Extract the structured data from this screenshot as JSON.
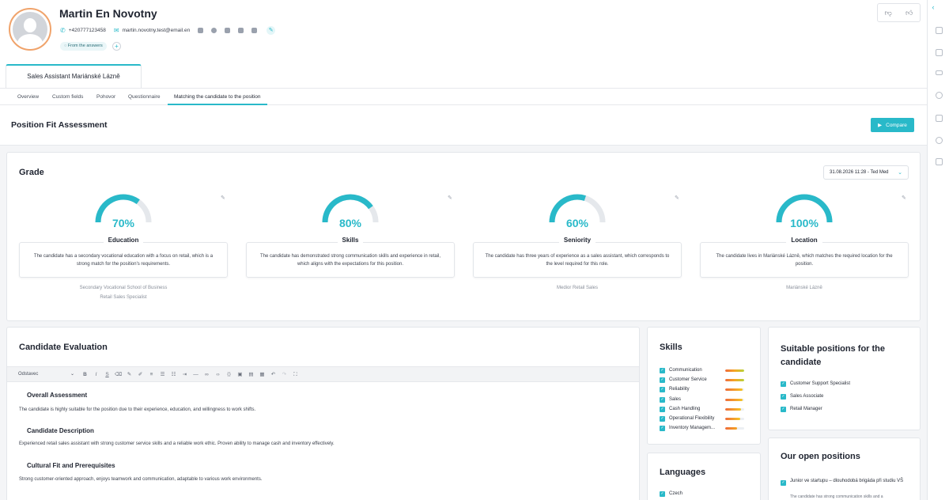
{
  "candidate": {
    "name": "Martin En Novotny",
    "phone": "+420777123458",
    "email": "martin.novotny.test@email.en",
    "answers_tag": "From the answers",
    "add_label": "+"
  },
  "position_tab": "Sales Assistant Mariánské Lázně",
  "subtabs": [
    "Overview",
    "Custom fields",
    "Pohovor",
    "Questionnaire",
    "Matching the candidate to the position"
  ],
  "header": {
    "title": "Position Fit Assessment",
    "compare_label": "Compare"
  },
  "grade": {
    "title": "Grade",
    "date_select": "31.08.2026 11:28 - Ted Med",
    "gauges": [
      {
        "label": "Education",
        "value": 70,
        "value_text": "70%",
        "description": "The candidate has a secondary vocational education with a focus on retail, which is a strong match for the position's requirements.",
        "extra": [
          "Secondary Vocational School of Business",
          "Retail Sales Specialist"
        ]
      },
      {
        "label": "Skills",
        "value": 80,
        "value_text": "80%",
        "description": "The candidate has demonstrated strong communication skills and experience in retail, which aligns with the expectations for this position.",
        "extra": []
      },
      {
        "label": "Seniority",
        "value": 60,
        "value_text": "60%",
        "description": "The candidate has three years of experience as a sales assistant, which corresponds to the level required for this role.",
        "extra": [
          "Medior Retail Sales"
        ]
      },
      {
        "label": "Location",
        "value": 100,
        "value_text": "100%",
        "description": "The candidate lives in Mariánské Lázně, which matches the required location for the position.",
        "extra": [
          "Mariánské Lázně"
        ]
      }
    ]
  },
  "evaluation": {
    "title": "Candidate Evaluation",
    "toolbar_paragraph": "Odstavec",
    "sections": [
      {
        "heading": "Overall Assessment",
        "text": "The candidate is highly suitable for the position due to their experience, education, and willingness to work shifts."
      },
      {
        "heading": "Candidate Description",
        "text": "Experienced retail sales assistant with strong customer service skills and a reliable work ethic. Proven ability to manage cash and inventory effectively."
      },
      {
        "heading": "Cultural Fit and Prerequisites",
        "text": "Strong customer-oriented approach, enjoys teamwork and communication, adaptable to various work environments."
      }
    ]
  },
  "skills": {
    "title": "Skills",
    "items": [
      {
        "name": "Communication",
        "level": 1.0,
        "grade": "hi"
      },
      {
        "name": "Customer Service",
        "level": 1.0,
        "grade": "hi"
      },
      {
        "name": "Reliability",
        "level": 0.92,
        "grade": "mid"
      },
      {
        "name": "Sales",
        "level": 0.92,
        "grade": "mid"
      },
      {
        "name": "Cash Handling",
        "level": 0.85,
        "grade": "mid"
      },
      {
        "name": "Operational Flexibility",
        "level": 0.8,
        "grade": "mid"
      },
      {
        "name": "Inventory Managem...",
        "level": 0.62,
        "grade": "lo"
      }
    ]
  },
  "languages": {
    "title": "Languages",
    "items": [
      "Czech"
    ]
  },
  "suitable_positions": {
    "title": "Suitable positions for the candidate",
    "items": [
      "Customer Support Specialist",
      "Sales Associate",
      "Retail Manager"
    ]
  },
  "open_positions": {
    "title": "Our open positions",
    "items": [
      {
        "title": "Junior ve startupu – dlouhodobá brigáda při studiu VŠ",
        "snippet": "The candidate has strong communication skills and a"
      }
    ]
  },
  "colors": {
    "accent": "#29b9c9",
    "avatar_ring": "#f0a36b"
  }
}
